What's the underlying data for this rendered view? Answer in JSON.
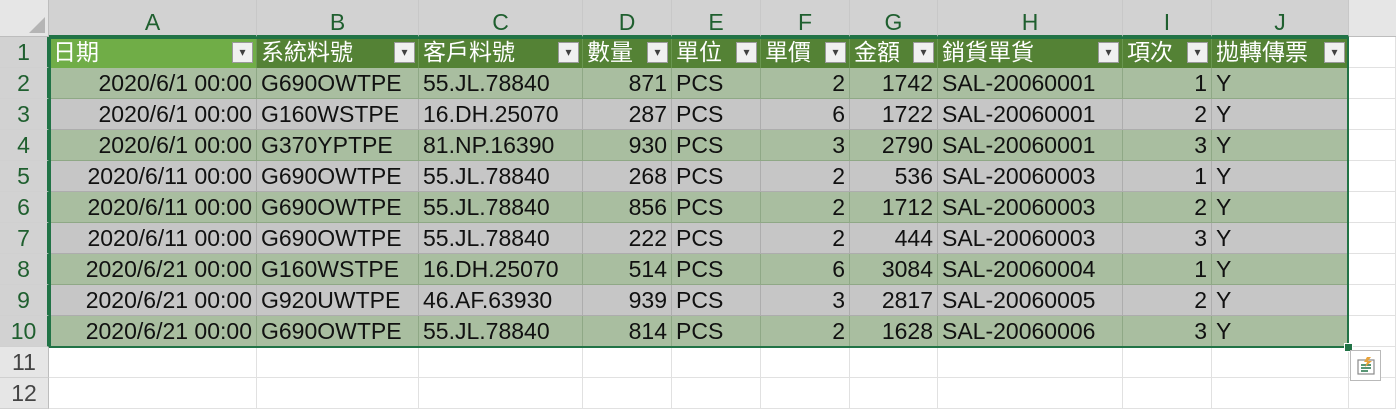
{
  "spreadsheet": {
    "column_letters": [
      "A",
      "B",
      "C",
      "D",
      "E",
      "F",
      "G",
      "H",
      "I",
      "J"
    ],
    "row_numbers": [
      "1",
      "2",
      "3",
      "4",
      "5",
      "6",
      "7",
      "8",
      "9",
      "10",
      "11",
      "12"
    ],
    "table": {
      "headers": [
        "日期",
        "系統料號",
        "客戶料號",
        "數量",
        "單位",
        "單價",
        "金額",
        "銷貨單貨",
        "項次",
        "拋轉傳票"
      ],
      "rows": [
        [
          "2020/6/1 00:00",
          "G690OWTPE",
          "55.JL.78840",
          "871",
          "PCS",
          "2",
          "1742",
          "SAL-20060001",
          "1",
          "Y"
        ],
        [
          "2020/6/1 00:00",
          "G160WSTPE",
          "16.DH.25070",
          "287",
          "PCS",
          "6",
          "1722",
          "SAL-20060001",
          "2",
          "Y"
        ],
        [
          "2020/6/1 00:00",
          "G370YPTPE",
          "81.NP.16390",
          "930",
          "PCS",
          "3",
          "2790",
          "SAL-20060001",
          "3",
          "Y"
        ],
        [
          "2020/6/11 00:00",
          "G690OWTPE",
          "55.JL.78840",
          "268",
          "PCS",
          "2",
          "536",
          "SAL-20060003",
          "1",
          "Y"
        ],
        [
          "2020/6/11 00:00",
          "G690OWTPE",
          "55.JL.78840",
          "856",
          "PCS",
          "2",
          "1712",
          "SAL-20060003",
          "2",
          "Y"
        ],
        [
          "2020/6/11 00:00",
          "G690OWTPE",
          "55.JL.78840",
          "222",
          "PCS",
          "2",
          "444",
          "SAL-20060003",
          "3",
          "Y"
        ],
        [
          "2020/6/21 00:00",
          "G160WSTPE",
          "16.DH.25070",
          "514",
          "PCS",
          "6",
          "3084",
          "SAL-20060004",
          "1",
          "Y"
        ],
        [
          "2020/6/21 00:00",
          "G920UWTPE",
          "46.AF.63930",
          "939",
          "PCS",
          "3",
          "2817",
          "SAL-20060005",
          "2",
          "Y"
        ],
        [
          "2020/6/21 00:00",
          "G690OWTPE",
          "55.JL.78840",
          "814",
          "PCS",
          "2",
          "1628",
          "SAL-20060006",
          "3",
          "Y"
        ]
      ]
    },
    "filter_icon": "dropdown-arrow-icon",
    "quick_analysis_icon": "quick-analysis-icon",
    "colors": {
      "header_first": "#70ad47",
      "header": "#548235",
      "band_green": "#a9bea0",
      "band_gray": "#c6c6c6",
      "selection": "#217346"
    }
  }
}
